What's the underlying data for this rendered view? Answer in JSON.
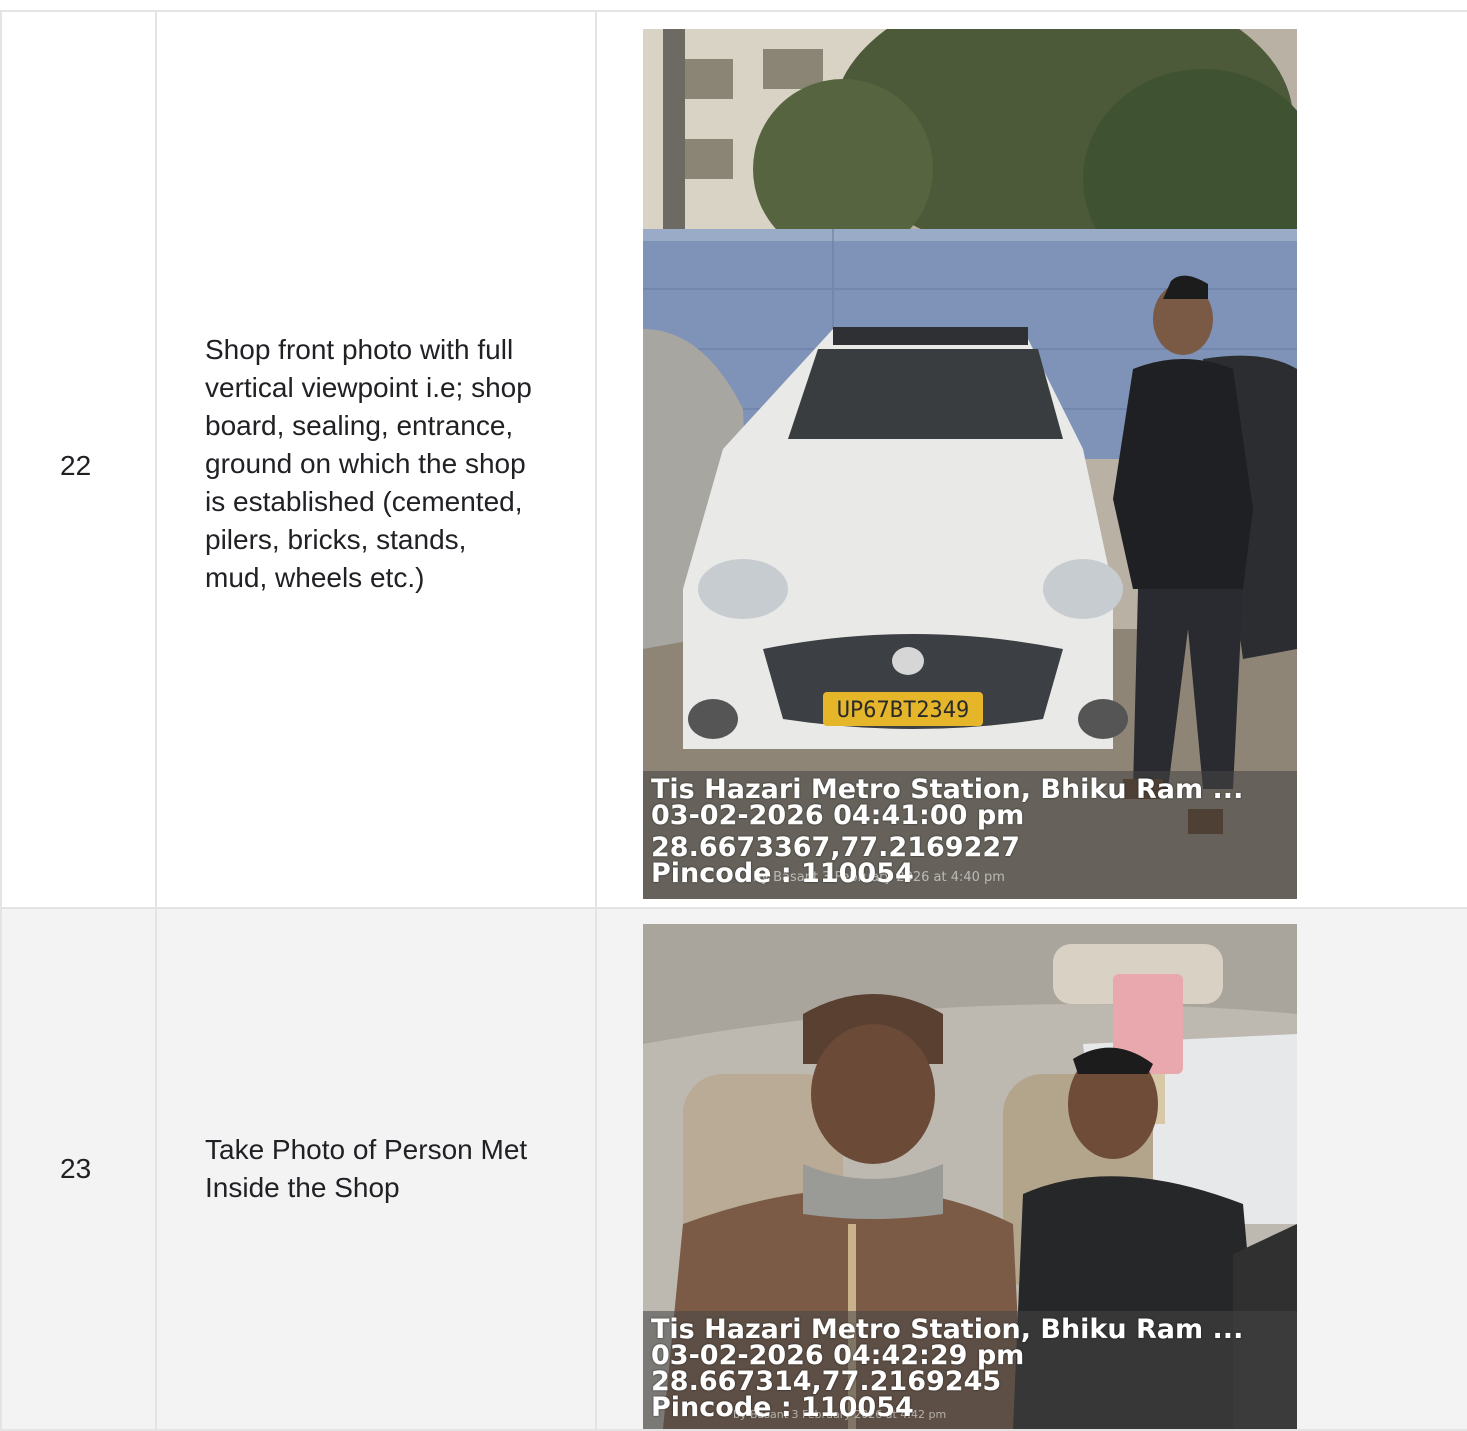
{
  "rows": [
    {
      "number": "22",
      "description_lines": [
        "Shop front photo with full",
        "vertical viewpoint i.e; shop",
        "board, sealing, entrance,",
        "ground on which the shop",
        "is established (cemented,",
        "pilers, bricks, stands,",
        "mud, wheels etc.)"
      ],
      "photo": {
        "location": "Tis Hazari Metro Station, Bhiku Ram ...",
        "datetime": "03-02-2026 04:41:00 pm",
        "coordinates": "28.6673367,77.2169227",
        "pincode": "Pincode : 110054",
        "plate": "UP67BT2349",
        "watermark": "by Basant 3 February 2026 at 4:40 pm"
      }
    },
    {
      "number": "23",
      "description_lines": [
        "Take Photo of Person Met",
        "Inside the Shop"
      ],
      "photo": {
        "location": "Tis Hazari Metro Station, Bhiku Ram ...",
        "datetime": "03-02-2026 04:42:29 pm",
        "coordinates": "28.667314,77.2169245",
        "pincode": "Pincode : 110054",
        "watermark": "by Basant 3 February 2026 at 4:42 pm"
      }
    }
  ]
}
